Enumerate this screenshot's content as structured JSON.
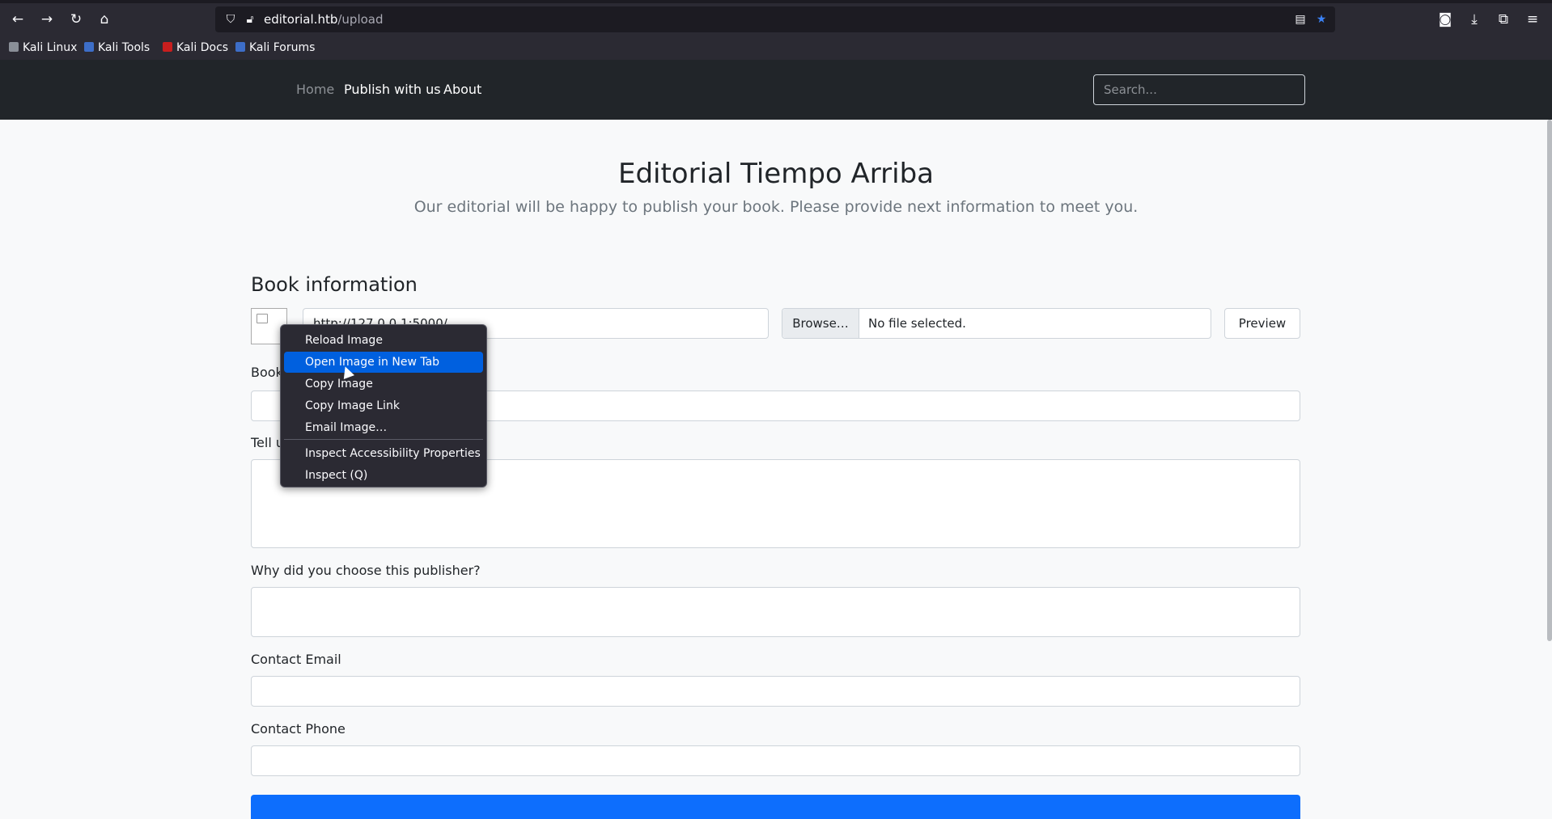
{
  "browser": {
    "url_host": "editorial.htb",
    "url_path": "/upload",
    "nav_icons": [
      "back-icon",
      "forward-icon",
      "reload-icon",
      "home-icon"
    ],
    "toolbar_icons": [
      "pocket-icon",
      "download-icon",
      "extensions-icon",
      "menu-icon"
    ],
    "bookmarks": [
      {
        "label": "Kali Linux",
        "color": "#8a8f98"
      },
      {
        "label": "Kali Tools",
        "color": "#3d6ec8"
      },
      {
        "label": "Kali Docs",
        "color": "#c81e1e"
      },
      {
        "label": "Kali Forums",
        "color": "#3d6ec8"
      }
    ]
  },
  "site_nav": {
    "links": [
      "Home",
      "Publish with us",
      "About"
    ],
    "search_placeholder": "Search..."
  },
  "hero": {
    "title": "Editorial Tiempo Arriba",
    "subtitle": "Our editorial will be happy to publish your book. Please provide next information to meet you."
  },
  "form": {
    "section_title": "Book information",
    "cover_url_value": "http://127.0.0.1:5000/",
    "browse_label": "Browse…",
    "file_status": "No file selected.",
    "preview_label": "Preview",
    "book_name_label": "Book",
    "tell_us_label": "Tell u",
    "why_label": "Why did you choose this publisher?",
    "email_label": "Contact Email",
    "phone_label": "Contact Phone"
  },
  "context_menu": {
    "items": [
      "Reload Image",
      "Open Image in New Tab",
      "Copy Image",
      "Copy Image Link",
      "Email Image…",
      "Inspect Accessibility Properties",
      "Inspect (Q)"
    ],
    "active_item": "Open Image in New Tab"
  },
  "colors": {
    "chrome_bg": "#2b2a33",
    "navbar_bg": "#212529",
    "accent": "#0d6efd",
    "menu_highlight": "#0060df"
  }
}
